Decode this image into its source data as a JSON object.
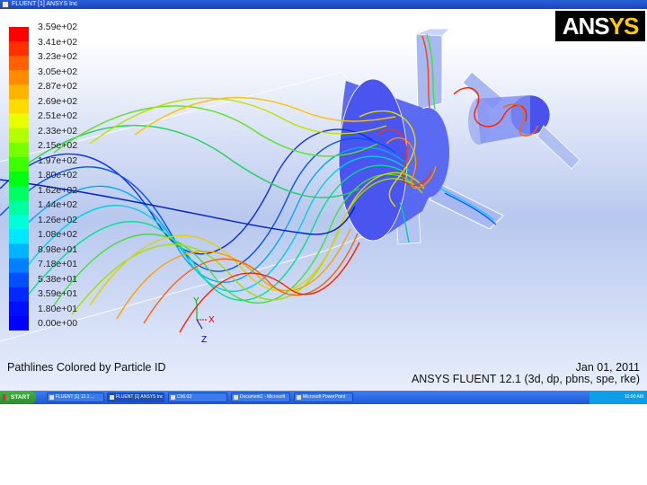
{
  "window": {
    "title": "FLUENT [1] ANSYS Inc"
  },
  "logo": {
    "text_main": "ANS",
    "text_accent": "YS"
  },
  "legend": {
    "labels": [
      "3.59e+02",
      "3.41e+02",
      "3.23e+02",
      "3.05e+02",
      "2.87e+02",
      "2.69e+02",
      "2.51e+02",
      "2.33e+02",
      "2.15e+02",
      "1.97e+02",
      "1.80e+02",
      "1.62e+02",
      "1.44e+02",
      "1.26e+02",
      "1.08e+02",
      "8.98e+01",
      "7.18e+01",
      "5.38e+01",
      "3.59e+01",
      "1.80e+01",
      "0.00e+00"
    ],
    "colors": [
      "#ff0000",
      "#ff3000",
      "#ff6000",
      "#ff8c00",
      "#ffb400",
      "#ffdc00",
      "#e8ff00",
      "#b4ff00",
      "#78ff00",
      "#3cff00",
      "#00ff10",
      "#00ff60",
      "#00ffa0",
      "#00ffd8",
      "#00e8ff",
      "#00b4ff",
      "#0080ff",
      "#0050ff",
      "#0028ff",
      "#0010ff",
      "#0000ff"
    ]
  },
  "axes": {
    "y": "Y",
    "x": "X",
    "z": "Z"
  },
  "caption": "Pathlines Colored by Particle ID",
  "date": "Jan 01, 2011",
  "version": "ANSYS FLUENT 12.1 (3d, dp, pbns, spe, rke)",
  "taskbar": {
    "start": "START",
    "tasks": [
      "FLUENT [1] 12.1 ...",
      "FLUENT [1] ANSYS Inc",
      "Ch6 03",
      "Document1 - Microsoft",
      "Microsoft PowerPoint"
    ],
    "tray": "10:00 AM"
  }
}
